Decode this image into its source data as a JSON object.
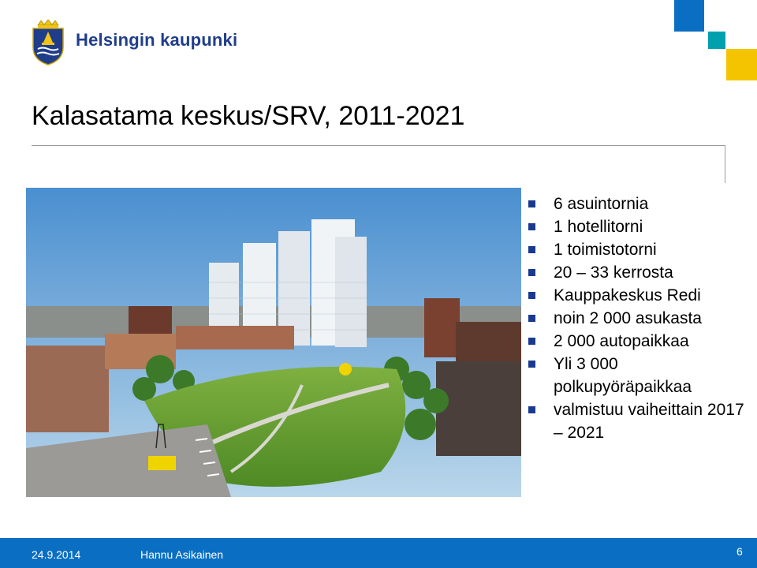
{
  "header": {
    "brand": "Helsingin kaupunki",
    "logo_icon": "helsinki-coat-of-arms-icon",
    "accent_colors": [
      "#0a6fc2",
      "#00a0af",
      "#f5c400"
    ]
  },
  "slide": {
    "title": "Kalasatama keskus/SRV, 2011-2021",
    "image_icon": "kalasatama-rendering-photo",
    "bullets": [
      "6 asuintornia",
      "1 hotellitorni",
      "1 toimistotorni",
      "20 – 33 kerrosta",
      "Kauppakeskus Redi",
      "noin 2 000 asukasta",
      "2 000 autopaikkaa",
      "Yli 3 000 polkupyöräpaikkaa",
      "valmistuu vaiheittain 2017 – 2021"
    ]
  },
  "footer": {
    "date": "24.9.2014",
    "author": "Hannu Asikainen",
    "page": "6"
  }
}
